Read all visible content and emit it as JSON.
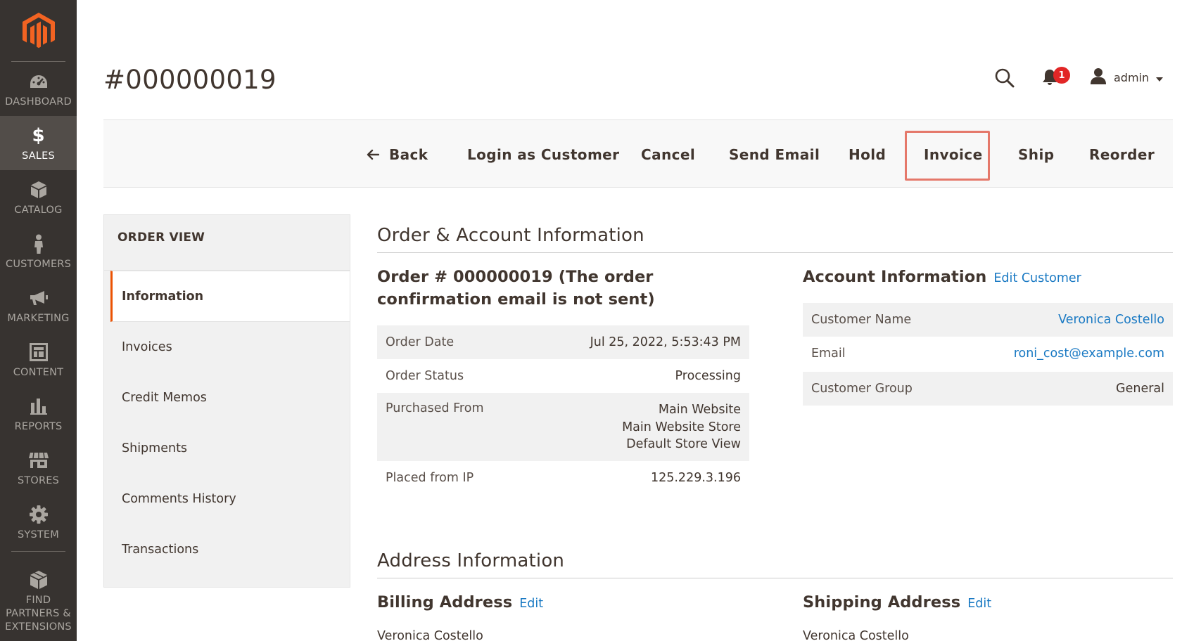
{
  "app": {
    "accent": "#eb5202",
    "link_color": "#1979c3",
    "menu_bg": "#373330"
  },
  "menu": {
    "items": [
      {
        "key": "dashboard",
        "label": "DASHBOARD",
        "icon": "dashboard-icon"
      },
      {
        "key": "sales",
        "label": "SALES",
        "icon": "dollar-icon",
        "active": true
      },
      {
        "key": "catalog",
        "label": "CATALOG",
        "icon": "cube-icon"
      },
      {
        "key": "customers",
        "label": "CUSTOMERS",
        "icon": "person-icon"
      },
      {
        "key": "marketing",
        "label": "MARKETING",
        "icon": "megaphone-icon"
      },
      {
        "key": "content",
        "label": "CONTENT",
        "icon": "layout-icon"
      },
      {
        "key": "reports",
        "label": "REPORTS",
        "icon": "bar-chart-icon"
      },
      {
        "key": "stores",
        "label": "STORES",
        "icon": "storefront-icon"
      },
      {
        "key": "system",
        "label": "SYSTEM",
        "icon": "gear-icon"
      },
      {
        "key": "partners",
        "label": "FIND PARTNERS & EXTENSIONS",
        "icon": "boxes-icon"
      }
    ]
  },
  "header": {
    "title": "#000000019",
    "notifications_count": "1",
    "user_name": "admin"
  },
  "actions": {
    "back": "Back",
    "login_as_customer": "Login as Customer",
    "cancel": "Cancel",
    "send_email": "Send Email",
    "hold": "Hold",
    "invoice": "Invoice",
    "ship": "Ship",
    "reorder": "Reorder"
  },
  "order_view": {
    "title": "ORDER VIEW",
    "tabs": [
      "Information",
      "Invoices",
      "Credit Memos",
      "Shipments",
      "Comments History",
      "Transactions"
    ]
  },
  "order_account": {
    "section_title": "Order & Account Information",
    "order_title": "Order # 000000019 (The order confirmation email is not sent)",
    "order_rows": [
      {
        "label": "Order Date",
        "value": "Jul 25, 2022, 5:53:43 PM"
      },
      {
        "label": "Order Status",
        "value": "Processing"
      },
      {
        "label": "Purchased From",
        "value_lines": [
          "Main Website",
          "Main Website Store",
          "Default Store View"
        ]
      },
      {
        "label": "Placed from IP",
        "value": "125.229.3.196"
      }
    ],
    "account_title": "Account Information",
    "account_edit": "Edit Customer",
    "account_rows": [
      {
        "label": "Customer Name",
        "value": "Veronica Costello"
      },
      {
        "label": "Email",
        "value": "roni_cost@example.com"
      },
      {
        "label": "Customer Group",
        "value": "General"
      }
    ]
  },
  "address": {
    "section_title": "Address Information",
    "billing_title": "Billing Address",
    "billing_edit": "Edit",
    "billing_name": "Veronica Costello",
    "shipping_title": "Shipping Address",
    "shipping_edit": "Edit",
    "shipping_name": "Veronica Costello"
  }
}
